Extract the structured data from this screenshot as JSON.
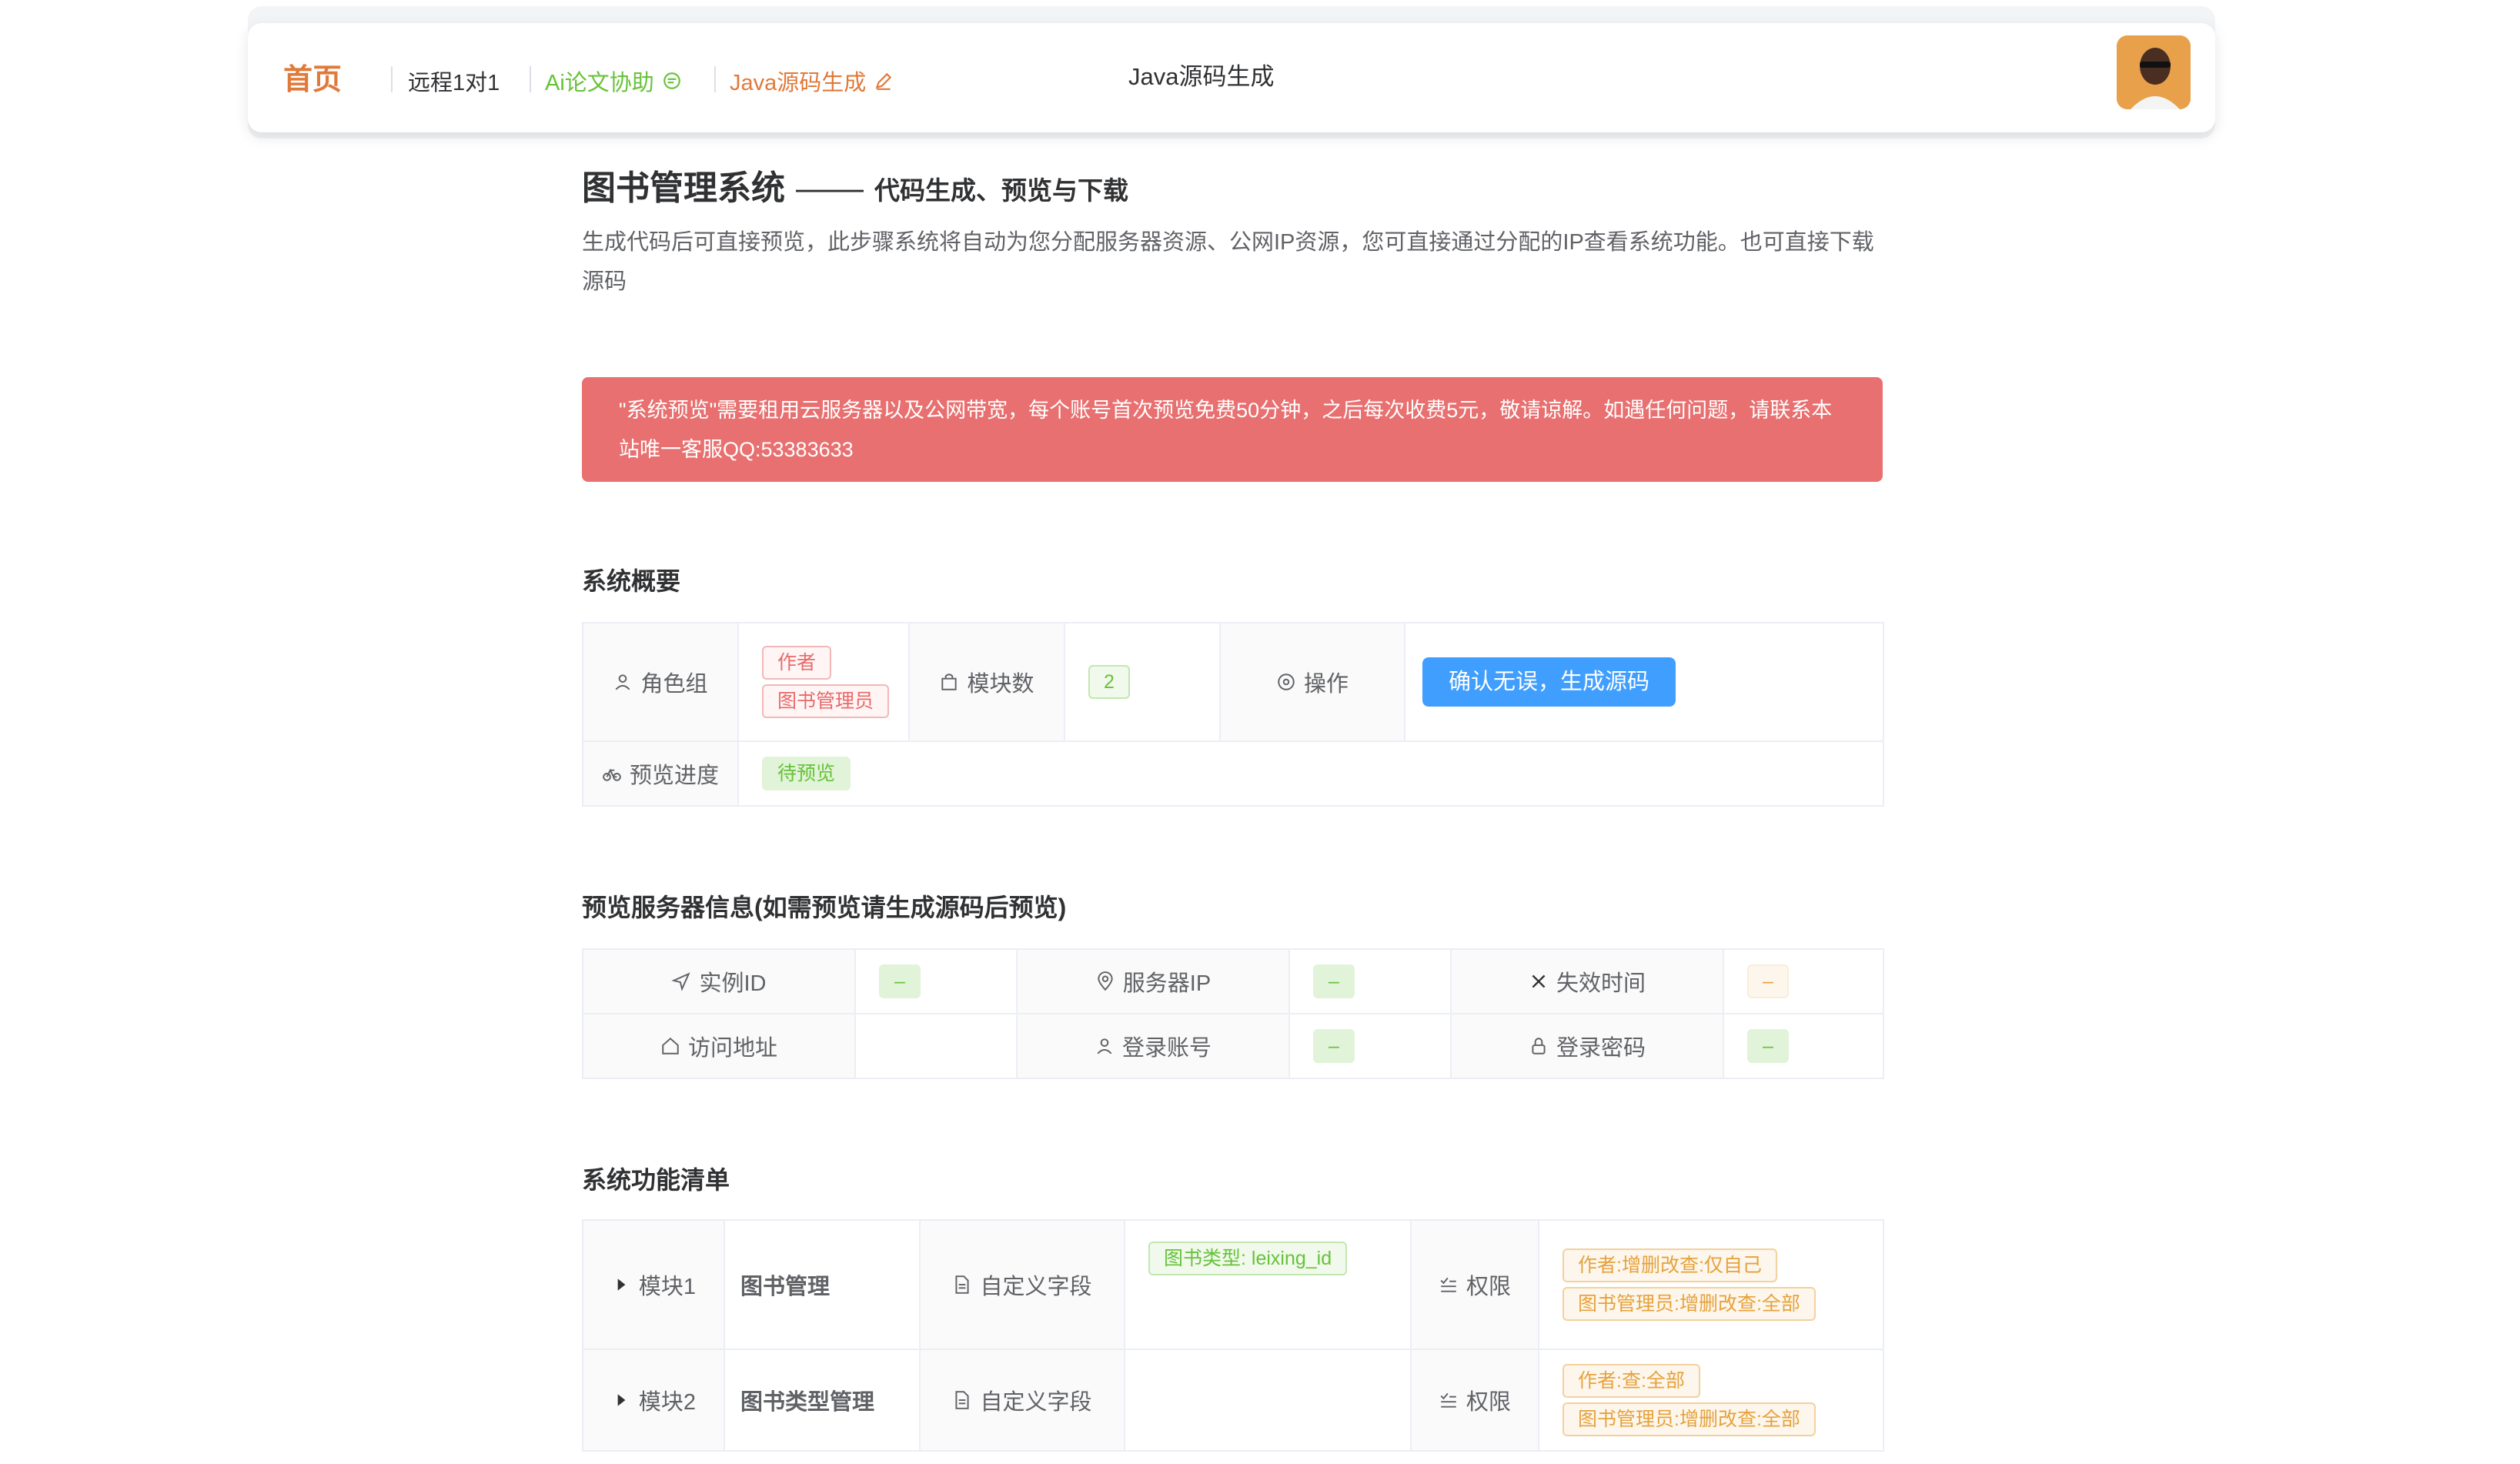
{
  "nav": {
    "home": "首页",
    "items": [
      {
        "label": "远程1对1",
        "color": "#303133"
      },
      {
        "label": "Ai论文协助",
        "color": "#67c23a"
      },
      {
        "label": "Java源码生成",
        "color": "#e07a3a"
      }
    ],
    "center_title": "Java源码生成"
  },
  "page": {
    "title": "图书管理系统",
    "dash": "——",
    "subtitle": "代码生成、预览与下载",
    "intro": "生成代码后可直接预览，此步骤系统将自动为您分配服务器资源、公网IP资源，您可直接通过分配的IP查看系统功能。也可直接下载源码"
  },
  "alert": {
    "text": "\"系统预览\"需要租用云服务器以及公网带宽，每个账号首次预览免费50分钟，之后每次收费5元，敬请谅解。如遇任何问题，请联系本站唯一客服QQ:53383633"
  },
  "overview": {
    "title": "系统概要",
    "role_label": "角色组",
    "roles": [
      "作者",
      "图书管理员"
    ],
    "module_count_label": "模块数",
    "module_count": "2",
    "action_label": "操作",
    "confirm_button": "确认无误，生成源码",
    "progress_label": "预览进度",
    "progress_value": "待预览"
  },
  "server": {
    "title": "预览服务器信息(如需预览请生成源码后预览)",
    "instance_label": "实例ID",
    "instance_value": "–",
    "ip_label": "服务器IP",
    "ip_value": "–",
    "expire_label": "失效时间",
    "expire_value": "–",
    "url_label": "访问地址",
    "url_value": "",
    "account_label": "登录账号",
    "account_value": "–",
    "password_label": "登录密码",
    "password_value": "–"
  },
  "features": {
    "title": "系统功能清单",
    "custom_field_label": "自定义字段",
    "permission_label": "权限",
    "modules": [
      {
        "label": "模块1",
        "name": "图书管理",
        "fields": [
          "图书类型: leixing_id"
        ],
        "permissions": [
          "作者:增删改查:仅自己",
          "图书管理员:增删改查:全部"
        ]
      },
      {
        "label": "模块2",
        "name": "图书类型管理",
        "fields": [],
        "permissions": [
          "作者:查:全部",
          "图书管理员:增删改查:全部"
        ]
      }
    ]
  }
}
